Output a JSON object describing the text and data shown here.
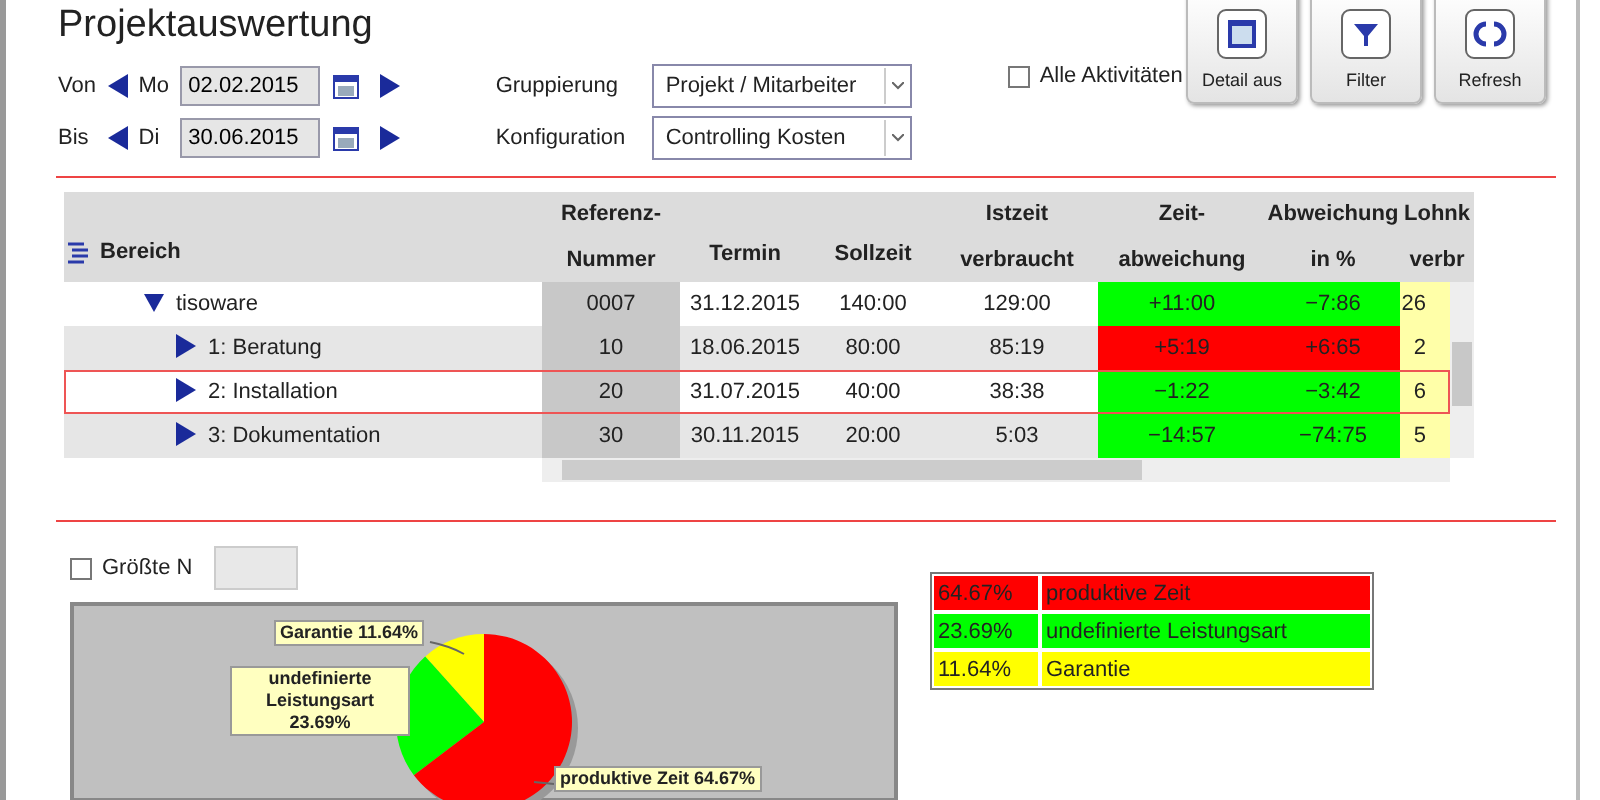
{
  "title": "Projektauswertung",
  "period": [
    {
      "label": "Von",
      "day": "Mo",
      "date": "02.02.2015"
    },
    {
      "label": "Bis",
      "day": "Di",
      "date": "30.06.2015"
    }
  ],
  "selects": [
    {
      "label": "Gruppierung",
      "value": "Projekt / Mitarbeiter"
    },
    {
      "label": "Konfiguration",
      "value": "Controlling Kosten"
    }
  ],
  "all_activities": {
    "label": "Alle Aktivitäten",
    "checked": false
  },
  "toolbar": [
    {
      "kind": "detail",
      "label": "Detail aus"
    },
    {
      "kind": "filter",
      "label": "Filter"
    },
    {
      "kind": "refresh",
      "label": "Refresh"
    }
  ],
  "table": {
    "columns": [
      {
        "lines": [
          "Bereich"
        ]
      },
      {
        "lines": [
          "Referenz-",
          "Nummer"
        ]
      },
      {
        "lines": [
          "Termin"
        ]
      },
      {
        "lines": [
          "Sollzeit"
        ]
      },
      {
        "lines": [
          "Istzeit",
          "verbraucht"
        ]
      },
      {
        "lines": [
          "Zeit-",
          "abweichung"
        ]
      },
      {
        "lines": [
          "Abweichung",
          "in %"
        ]
      },
      {
        "lines": [
          "Lohnk",
          "verbr"
        ]
      }
    ],
    "rows": [
      {
        "expanded": true,
        "selected": false,
        "color": "#00ff00",
        "cells": [
          "tisoware",
          "0007",
          "31.12.2015",
          "140:00",
          "129:00",
          "+11:00",
          "−7:86",
          "26"
        ],
        "children": [
          {
            "expanded": false,
            "selected": false,
            "color": "#ff0000",
            "cells": [
              "1: Beratung",
              "10",
              "18.06.2015",
              "80:00",
              "85:19",
              "+5:19",
              "+6:65",
              "2"
            ]
          },
          {
            "expanded": false,
            "selected": true,
            "color": "#00ff00",
            "cells": [
              "2: Installation",
              "20",
              "31.07.2015",
              "40:00",
              "38:38",
              "−1:22",
              "−3:42",
              "6"
            ]
          },
          {
            "expanded": false,
            "selected": false,
            "color": "#00ff00",
            "cells": [
              "3: Dokumentation",
              "30",
              "30.11.2015",
              "20:00",
              "5:03",
              "−14:57",
              "−74:75",
              "5"
            ]
          }
        ]
      }
    ]
  },
  "top_n": {
    "label": "Größte N",
    "checked": false
  },
  "chart": {
    "chart_data": {
      "type": "pie",
      "categories": [
        "Garantie",
        "undefinierte Leistungsart",
        "produktive Zeit"
      ],
      "values": [
        11.64,
        23.69,
        64.67
      ],
      "value_labels": [
        "11.64%",
        "23.69%",
        "64.67%"
      ]
    }
  },
  "legend": [
    {
      "percent": "64.67%",
      "name": "produktive Zeit",
      "color": "#ff0000"
    },
    {
      "percent": "23.69%",
      "name": "undefinierte Leistungsart",
      "color": "#00ff00"
    },
    {
      "percent": "11.64%",
      "name": "Garantie",
      "color": "#ffff00"
    }
  ]
}
